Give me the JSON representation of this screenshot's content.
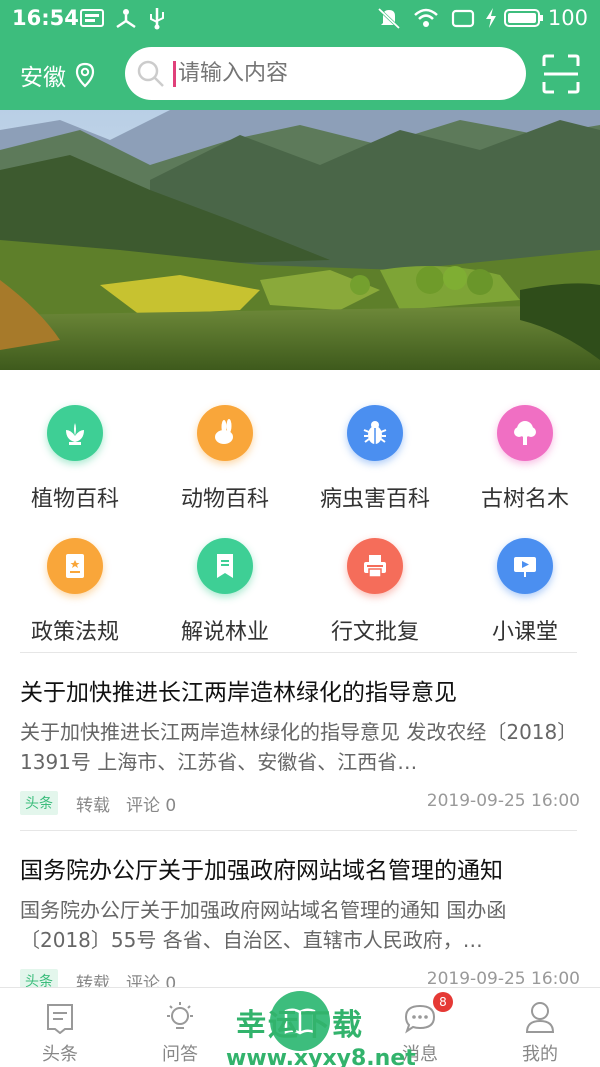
{
  "status_bar": {
    "time": "16:54",
    "battery": "100"
  },
  "header": {
    "location": "安徽",
    "search_placeholder": "请输入内容"
  },
  "categories": [
    {
      "label": "植物百科",
      "icon": "plant-icon",
      "color": "#3ecf95"
    },
    {
      "label": "动物百科",
      "icon": "rabbit-icon",
      "color": "#f9a63a"
    },
    {
      "label": "病虫害百科",
      "icon": "bug-icon",
      "color": "#4b8ff0"
    },
    {
      "label": "古树名木",
      "icon": "tree-icon",
      "color": "#f06fc3"
    },
    {
      "label": "政策法规",
      "icon": "policy-doc-icon",
      "color": "#f9a63a"
    },
    {
      "label": "解说林业",
      "icon": "bookmark-icon",
      "color": "#3ecf95"
    },
    {
      "label": "行文批复",
      "icon": "printer-icon",
      "color": "#f56d5a"
    },
    {
      "label": "小课堂",
      "icon": "presentation-icon",
      "color": "#4b8ff0"
    }
  ],
  "news": [
    {
      "title": "关于加快推进长江两岸造林绿化的指导意见",
      "desc": "关于加快推进长江两岸造林绿化的指导意见 发改农经〔2018〕1391号 上海市、江苏省、安徽省、江西省…",
      "tag": "头条",
      "source": "转载",
      "comments": "评论 0",
      "date": "2019-09-25 16:00"
    },
    {
      "title": "国务院办公厅关于加强政府网站域名管理的通知",
      "desc": "国务院办公厅关于加强政府网站域名管理的通知 国办函〔2018〕55号 各省、自治区、直辖市人民政府，…",
      "tag": "头条",
      "source": "转载",
      "comments": "评论 0",
      "date": "2019-09-25 16:00"
    }
  ],
  "tabbar": {
    "tabs": [
      {
        "label": "头条",
        "icon": "news-icon"
      },
      {
        "label": "问答",
        "icon": "bulb-icon"
      },
      {
        "label": "消息",
        "icon": "chat-icon"
      },
      {
        "label": "我的",
        "icon": "user-icon"
      }
    ],
    "message_badge": "8"
  },
  "watermark": {
    "line1": "幸运下载",
    "line2": "www.xyxy8.net"
  },
  "colors": {
    "brand_green": "#3dbd7d",
    "badge_red": "#e53935"
  }
}
